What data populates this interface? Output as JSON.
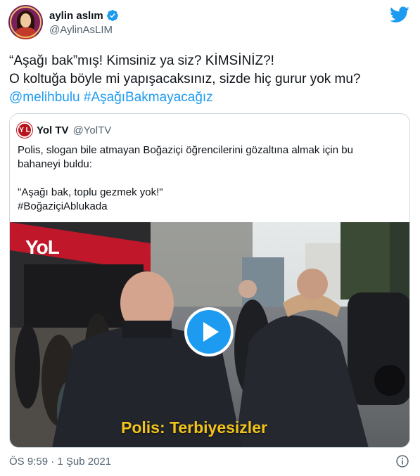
{
  "author": {
    "name": "aylin aslım",
    "handle": "@AylinAsLIM",
    "verified_icon": "verified-badge-icon"
  },
  "tweet": {
    "line1": "“Aşağı bak”mış! Kimsiniz ya siz? KİMSİNİZ?!",
    "line2": "O koltuğa böyle mi yapışacaksınız, sizde hiç gurur yok mu?",
    "mention": "@melihbulu",
    "hashtag": "#AşağıBakmayacağız"
  },
  "quoted": {
    "avatar_text": "Y L",
    "name": "Yol TV",
    "handle": "@YolTV",
    "text_line1": "Polis, slogan bile atmayan Boğaziçi öğrencilerini gözaltına almak için bu",
    "text_line2": "bahaneyi buldu:",
    "quote_line": "\"Aşağı bak, toplu gezmek yok!\"",
    "hashtag": "#BoğaziçiAblukada",
    "video": {
      "watermark": "YoL",
      "caption": "Polis: Terbiyesizler",
      "play_icon": "play-icon"
    }
  },
  "timestamp": "ÖS 9:59 · 1 Şub 2021",
  "colors": {
    "link": "#1d9bf0",
    "text": "#0f1419",
    "muted": "#536471",
    "caption": "#f2c31a"
  }
}
